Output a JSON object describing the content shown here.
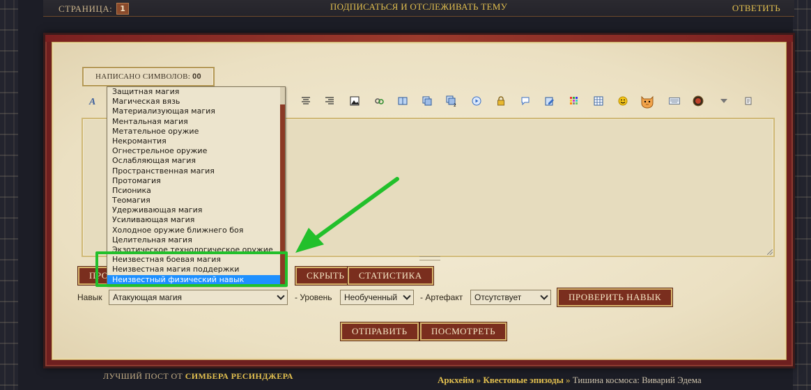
{
  "topbar": {
    "page_label": "СТРАНИЦА:",
    "page_number": "1",
    "subscribe": "ПОДПИСАТЬСЯ И ОТСЛЕЖИВАТЬ ТЕМУ",
    "reply": "ОТВЕТИТЬ"
  },
  "editor": {
    "counter_label": "НАПИСАНО СИМВОЛОВ:",
    "counter_value": "00",
    "toolbar_icons": [
      "font-style-icon",
      "align-center-icon",
      "align-right-icon",
      "image-icon",
      "link-icon",
      "book-icon",
      "copy-icon",
      "copy-2-icon",
      "play-icon",
      "lock-icon",
      "speech-bubble-icon",
      "pencil-icon",
      "colors-icon",
      "table-icon",
      "smiley-icon",
      "cat-sticker-icon",
      "keyboard-icon",
      "gem-icon",
      "triangle-down-icon",
      "scroll-icon"
    ]
  },
  "buttons": {
    "preview_partial": "ПРО",
    "hide": "СКРЫТЬ",
    "stats": "СТАТИСТИКА",
    "check_skill": "ПРОВЕРИТЬ НАВЫК",
    "send": "ОТПРАВИТЬ",
    "view": "ПОСМОТРЕТЬ"
  },
  "skill_row": {
    "skill_label": "Навык",
    "skill_value": "Атакующая магия",
    "level_label": "- Уровень",
    "level_value": "Необученный",
    "artifact_label": "- Артефакт",
    "artifact_value": "Отсутствует"
  },
  "dropdown": {
    "options": [
      "Защитная магия",
      "Магическая вязь",
      "Материализующая магия",
      "Ментальная магия",
      "Метательное оружие",
      "Некромантия",
      "Огнестрельное оружие",
      "Ослабляющая магия",
      "Пространственная магия",
      "Протомагия",
      "Псионика",
      "Теомагия",
      "Удерживающая магия",
      "Усиливающая магия",
      "Холодное оружие ближнего боя",
      "Целительная магия",
      "Экзотическое технологическое оружие",
      "Неизвестная боевая магия",
      "Неизвестная магия поддержки",
      "Неизвестный физический навык"
    ],
    "selected": "Неизвестный физический навык"
  },
  "footer": {
    "best_post_label": "ЛУЧШИЙ ПОСТ ОТ",
    "best_post_author": "СИМБЕРА РЕСИНДЖЕРА",
    "crumb1": "Аркхейм",
    "crumb2": "Квестовые эпизоды",
    "crumb_sep": "»",
    "crumb3": "Тишина космоса: Виварий Эдема"
  },
  "colors": {
    "accent_gold": "#e3c04f",
    "button_red": "#7a2e1e",
    "frame_red": "#6e1f1f",
    "parchment": "#ebe0c2",
    "highlight_green": "#22c02b",
    "selected_blue": "#1e90ff"
  }
}
